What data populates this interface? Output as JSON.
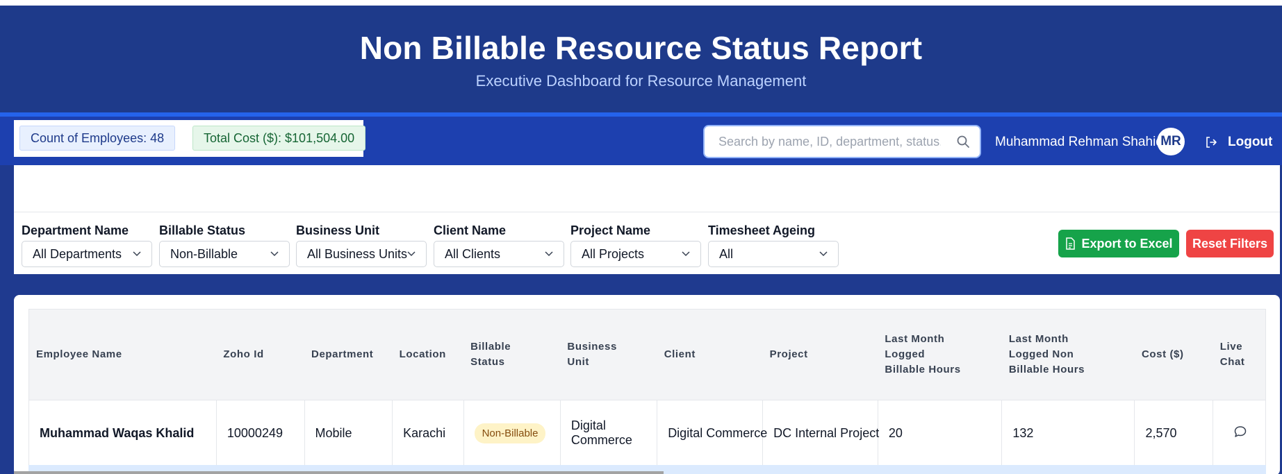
{
  "header": {
    "title": "Non Billable Resource Status Report",
    "subtitle": "Executive Dashboard for Resource Management"
  },
  "stats": {
    "count": "Count of Employees: 48",
    "cost": "Total Cost ($): $101,504.00"
  },
  "search": {
    "placeholder": "Search by name, ID, department, status..."
  },
  "user": {
    "name": "Muhammad Rehman Shahid",
    "initials": "MR"
  },
  "logout_label": "Logout",
  "filters": [
    {
      "label": "Department Name",
      "value": "All Departments"
    },
    {
      "label": "Billable Status",
      "value": "Non-Billable"
    },
    {
      "label": "Business Unit",
      "value": "All Business Units"
    },
    {
      "label": "Client Name",
      "value": "All Clients"
    },
    {
      "label": "Project Name",
      "value": "All Projects"
    },
    {
      "label": "Timesheet Ageing",
      "value": "All"
    }
  ],
  "buttons": {
    "export": "Export to Excel",
    "reset": "Reset Filters"
  },
  "table": {
    "headers": [
      "Employee Name",
      "Zoho Id",
      "Department",
      "Location",
      "Billable\nStatus",
      "Business\nUnit",
      "Client",
      "Project",
      "Last Month\nLogged\nBillable Hours",
      "Last Month\nLogged Non\nBillable Hours",
      "Cost ($)",
      "Live\nChat"
    ],
    "rows": [
      {
        "name": "Muhammad Waqas Khalid",
        "zoho_id": "10000249",
        "department": "Mobile",
        "location": "Karachi",
        "status": "Non-Billable",
        "business_unit": "Digital Commerce",
        "client": "Digital Commerce",
        "project": "DC Internal Project",
        "billable_hours": "20",
        "non_billable_hours": "132",
        "cost": "2,570"
      }
    ]
  },
  "colors": {
    "header_bg": "#1e3a8a",
    "nav_bg": "#1d40af",
    "export_btn": "#16a34a",
    "reset_btn": "#ef4444",
    "badge_bg": "#fef3c7"
  },
  "icons": {
    "search": "search-icon",
    "logout": "logout-icon",
    "export": "document-icon",
    "chat": "chat-bubble-icon",
    "dropdown": "chevron-down-icon"
  }
}
